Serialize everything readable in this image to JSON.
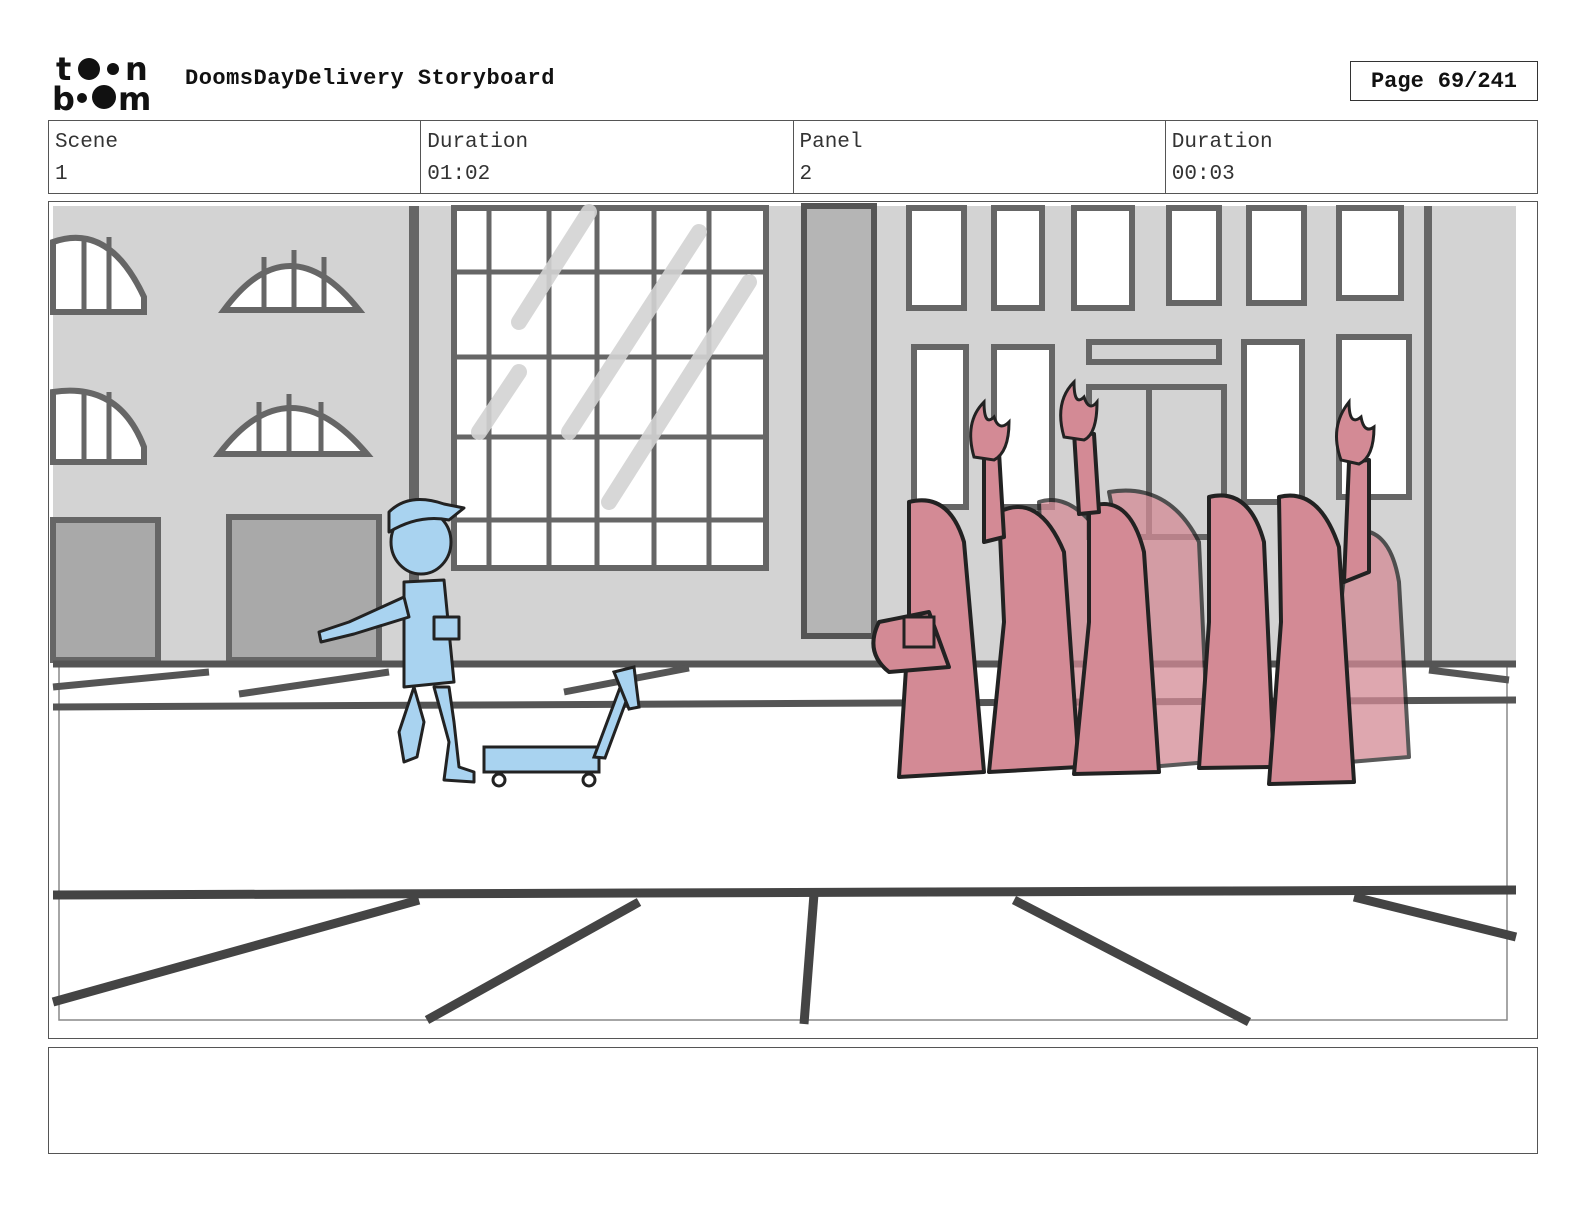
{
  "header": {
    "logo_text_top": "toon",
    "logo_text_bottom": "boom",
    "title": "DoomsDayDelivery Storyboard",
    "page_label": "Page",
    "page_value": "69/241"
  },
  "info": [
    {
      "label": "Scene",
      "value": "1"
    },
    {
      "label": "Duration",
      "value": "01:02"
    },
    {
      "label": "Panel",
      "value": "2"
    },
    {
      "label": "Duration",
      "value": "00:03"
    }
  ],
  "notes": "",
  "colors": {
    "character_blue": "#a9d3f0",
    "cultist_pink": "#d38a95",
    "building_gray": "#d0d0d0",
    "line_dark": "#222222"
  }
}
